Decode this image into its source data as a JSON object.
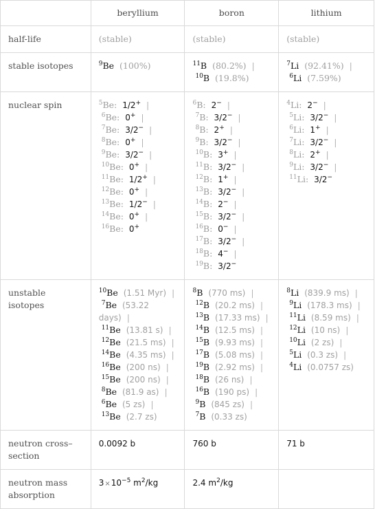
{
  "columns": [
    "",
    "beryllium",
    "boron",
    "lithium"
  ],
  "rows": {
    "half_life": {
      "label": "half-life",
      "values": [
        "(stable)",
        "(stable)",
        "(stable)"
      ]
    },
    "stable_isotopes": {
      "label": "stable isotopes",
      "beryllium": [
        {
          "mass": "9",
          "symbol": "Be",
          "abundance": "(100%)"
        }
      ],
      "boron": [
        {
          "mass": "11",
          "symbol": "B",
          "abundance": "(80.2%)"
        },
        {
          "mass": "10",
          "symbol": "B",
          "abundance": "(19.8%)"
        }
      ],
      "lithium": [
        {
          "mass": "7",
          "symbol": "Li",
          "abundance": "(92.41%)"
        },
        {
          "mass": "6",
          "symbol": "Li",
          "abundance": "(7.59%)"
        }
      ]
    },
    "nuclear_spin": {
      "label": "nuclear spin",
      "beryllium": [
        {
          "mass": "5",
          "symbol": "Be:",
          "spin": "1/2",
          "parity": "+"
        },
        {
          "mass": "6",
          "symbol": "Be:",
          "spin": "0",
          "parity": "+"
        },
        {
          "mass": "7",
          "symbol": "Be:",
          "spin": "3/2",
          "parity": "−"
        },
        {
          "mass": "8",
          "symbol": "Be:",
          "spin": "0",
          "parity": "+"
        },
        {
          "mass": "9",
          "symbol": "Be:",
          "spin": "3/2",
          "parity": "−"
        },
        {
          "mass": "10",
          "symbol": "Be:",
          "spin": "0",
          "parity": "+"
        },
        {
          "mass": "11",
          "symbol": "Be:",
          "spin": "1/2",
          "parity": "+"
        },
        {
          "mass": "12",
          "symbol": "Be:",
          "spin": "0",
          "parity": "+"
        },
        {
          "mass": "13",
          "symbol": "Be:",
          "spin": "1/2",
          "parity": "−"
        },
        {
          "mass": "14",
          "symbol": "Be:",
          "spin": "0",
          "parity": "+"
        },
        {
          "mass": "16",
          "symbol": "Be:",
          "spin": "0",
          "parity": "+"
        }
      ],
      "boron": [
        {
          "mass": "6",
          "symbol": "B:",
          "spin": "2",
          "parity": "−"
        },
        {
          "mass": "7",
          "symbol": "B:",
          "spin": "3/2",
          "parity": "−"
        },
        {
          "mass": "8",
          "symbol": "B:",
          "spin": "2",
          "parity": "+"
        },
        {
          "mass": "9",
          "symbol": "B:",
          "spin": "3/2",
          "parity": "−"
        },
        {
          "mass": "10",
          "symbol": "B:",
          "spin": "3",
          "parity": "+"
        },
        {
          "mass": "11",
          "symbol": "B:",
          "spin": "3/2",
          "parity": "−"
        },
        {
          "mass": "12",
          "symbol": "B:",
          "spin": "1",
          "parity": "+"
        },
        {
          "mass": "13",
          "symbol": "B:",
          "spin": "3/2",
          "parity": "−"
        },
        {
          "mass": "14",
          "symbol": "B:",
          "spin": "2",
          "parity": "−"
        },
        {
          "mass": "15",
          "symbol": "B:",
          "spin": "3/2",
          "parity": "−"
        },
        {
          "mass": "16",
          "symbol": "B:",
          "spin": "0",
          "parity": "−"
        },
        {
          "mass": "17",
          "symbol": "B:",
          "spin": "3/2",
          "parity": "−"
        },
        {
          "mass": "18",
          "symbol": "B:",
          "spin": "4",
          "parity": "−"
        },
        {
          "mass": "19",
          "symbol": "B:",
          "spin": "3/2",
          "parity": "−"
        }
      ],
      "lithium": [
        {
          "mass": "4",
          "symbol": "Li:",
          "spin": "2",
          "parity": "−"
        },
        {
          "mass": "5",
          "symbol": "Li:",
          "spin": "3/2",
          "parity": "−"
        },
        {
          "mass": "6",
          "symbol": "Li:",
          "spin": "1",
          "parity": "+"
        },
        {
          "mass": "7",
          "symbol": "Li:",
          "spin": "3/2",
          "parity": "−"
        },
        {
          "mass": "8",
          "symbol": "Li:",
          "spin": "2",
          "parity": "+"
        },
        {
          "mass": "9",
          "symbol": "Li:",
          "spin": "3/2",
          "parity": "−"
        },
        {
          "mass": "11",
          "symbol": "Li:",
          "spin": "3/2",
          "parity": "−"
        }
      ]
    },
    "unstable_isotopes": {
      "label": "unstable isotopes",
      "beryllium": [
        {
          "mass": "10",
          "symbol": "Be",
          "half_life": "(1.51 Myr)"
        },
        {
          "mass": "7",
          "symbol": "Be",
          "half_life": "(53.22 days)"
        },
        {
          "mass": "11",
          "symbol": "Be",
          "half_life": "(13.81 s)"
        },
        {
          "mass": "12",
          "symbol": "Be",
          "half_life": "(21.5 ms)"
        },
        {
          "mass": "14",
          "symbol": "Be",
          "half_life": "(4.35 ms)"
        },
        {
          "mass": "16",
          "symbol": "Be",
          "half_life": "(200 ns)"
        },
        {
          "mass": "15",
          "symbol": "Be",
          "half_life": "(200 ns)"
        },
        {
          "mass": "8",
          "symbol": "Be",
          "half_life": "(81.9 as)"
        },
        {
          "mass": "6",
          "symbol": "Be",
          "half_life": "(5 zs)"
        },
        {
          "mass": "13",
          "symbol": "Be",
          "half_life": "(2.7 zs)"
        }
      ],
      "boron": [
        {
          "mass": "8",
          "symbol": "B",
          "half_life": "(770 ms)"
        },
        {
          "mass": "12",
          "symbol": "B",
          "half_life": "(20.2 ms)"
        },
        {
          "mass": "13",
          "symbol": "B",
          "half_life": "(17.33 ms)"
        },
        {
          "mass": "14",
          "symbol": "B",
          "half_life": "(12.5 ms)"
        },
        {
          "mass": "15",
          "symbol": "B",
          "half_life": "(9.93 ms)"
        },
        {
          "mass": "17",
          "symbol": "B",
          "half_life": "(5.08 ms)"
        },
        {
          "mass": "19",
          "symbol": "B",
          "half_life": "(2.92 ms)"
        },
        {
          "mass": "18",
          "symbol": "B",
          "half_life": "(26 ns)"
        },
        {
          "mass": "16",
          "symbol": "B",
          "half_life": "(190 ps)"
        },
        {
          "mass": "9",
          "symbol": "B",
          "half_life": "(845 zs)"
        },
        {
          "mass": "7",
          "symbol": "B",
          "half_life": "(0.33 zs)"
        }
      ],
      "lithium": [
        {
          "mass": "8",
          "symbol": "Li",
          "half_life": "(839.9 ms)"
        },
        {
          "mass": "9",
          "symbol": "Li",
          "half_life": "(178.3 ms)"
        },
        {
          "mass": "11",
          "symbol": "Li",
          "half_life": "(8.59 ms)"
        },
        {
          "mass": "12",
          "symbol": "Li",
          "half_life": "(10 ns)"
        },
        {
          "mass": "10",
          "symbol": "Li",
          "half_life": "(2 zs)"
        },
        {
          "mass": "5",
          "symbol": "Li",
          "half_life": "(0.3 zs)"
        },
        {
          "mass": "4",
          "symbol": "Li",
          "half_life": "(0.0757 zs)"
        }
      ]
    },
    "neutron_cross_section": {
      "label": "neutron cross–section",
      "values": [
        "0.0092 b",
        "760 b",
        "71 b"
      ]
    },
    "neutron_mass_absorption": {
      "label": "neutron mass absorption",
      "beryllium": {
        "mantissa": "3",
        "times": "×",
        "base": "10",
        "exponent": "−5",
        "unit": "m",
        "unit_exp": "2",
        "unit_rest": "/kg"
      },
      "boron": {
        "mantissa": "2.4",
        "unit": "m",
        "unit_exp": "2",
        "unit_rest": "/kg"
      },
      "lithium": ""
    }
  },
  "separator": "|"
}
